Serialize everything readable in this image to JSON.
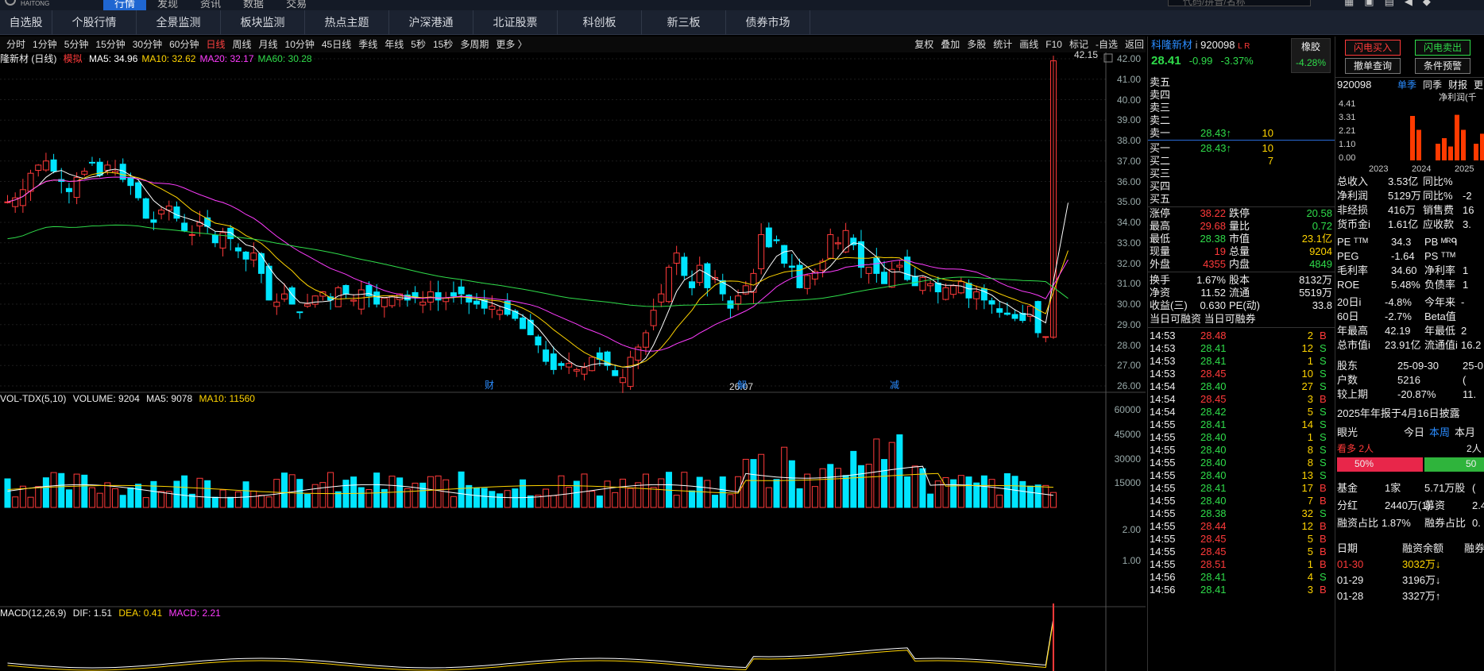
{
  "topbar": {
    "logo": "HAITONG",
    "menu": [
      "行情",
      "发现",
      "资讯",
      "数据",
      "交易"
    ],
    "active": 0,
    "search_placeholder": "代码/拼音/名称",
    "icons": [
      "grid-icon",
      "screen-icon",
      "quote-icon",
      "back-icon",
      "pin-icon"
    ]
  },
  "nav": [
    "自选股",
    "个股行情",
    "全景监测",
    "板块监测",
    "热点主题",
    "沪深港通",
    "北证股票",
    "科创板",
    "新三板",
    "债券市场"
  ],
  "periods": [
    "分时",
    "1分钟",
    "5分钟",
    "15分钟",
    "30分钟",
    "60分钟",
    "日线",
    "周线",
    "月线",
    "10分钟",
    "45日线",
    "季线",
    "年线",
    "5秒",
    "15秒",
    "多周期",
    "更多 〉"
  ],
  "active_period": "日线",
  "tools": [
    "复权",
    "叠加",
    "多股",
    "统计",
    "画线",
    "F10",
    "标记",
    "-自选",
    "返回"
  ],
  "main": {
    "title": "隆新材 (日线)",
    "mode": "模拟",
    "ma": [
      {
        "label": "MA5: 34.96",
        "color": "#ffffff"
      },
      {
        "label": "MA10: 32.62",
        "color": "#ffd400"
      },
      {
        "label": "MA20: 32.17",
        "color": "#ff3cff"
      },
      {
        "label": "MA60: 30.28",
        "color": "#2fdc4a"
      }
    ],
    "high_label": "42.15",
    "low_label": "26.07",
    "yaxis": [
      "42.00",
      "41.00",
      "40.00",
      "39.00",
      "38.00",
      "37.00",
      "36.00",
      "35.00",
      "34.00",
      "33.00",
      "32.00",
      "31.00",
      "30.00",
      "29.00",
      "28.00",
      "27.00",
      "26.00"
    ],
    "markers": [
      "财",
      "解",
      "减"
    ]
  },
  "vol": {
    "title": "VOL-TDX(5,10)",
    "volume": "VOLUME: 9204",
    "ma5": "MA5: 9078",
    "ma10": "MA10: 11560",
    "yaxis": [
      "60000",
      "45000",
      "30000",
      "15000"
    ]
  },
  "macd": {
    "title": "MACD(12,26,9)",
    "dif": "DIF: 1.51",
    "dea": "DEA: 0.41",
    "macd": "MACD: 2.21",
    "yaxis": [
      "2.00",
      "1.00"
    ]
  },
  "chart_data": {
    "type": "candlestick",
    "symbol": "920098",
    "period": "日线",
    "ylim": [
      26,
      42
    ],
    "ma": {
      "MA5": 34.96,
      "MA10": 32.62,
      "MA20": 32.17,
      "MA60": 30.28
    },
    "last": {
      "high": 42.15,
      "low_mark": 26.07
    },
    "volume": {
      "last": 9204,
      "ma5": 9078,
      "ma10": 11560,
      "ylim": [
        0,
        60000
      ]
    },
    "macd": {
      "dif": 1.51,
      "dea": 0.41,
      "macd": 2.21
    }
  },
  "quote": {
    "name": "科隆新材",
    "code": "920098",
    "flags": "L R",
    "price": "28.41",
    "change": "-0.99",
    "pct": "-3.37%",
    "sector": "橡胶",
    "sector_pct": "-4.28%",
    "asks": [
      {
        "label": "卖五",
        "p": "",
        "v": ""
      },
      {
        "label": "卖四",
        "p": "",
        "v": ""
      },
      {
        "label": "卖三",
        "p": "",
        "v": ""
      },
      {
        "label": "卖二",
        "p": "",
        "v": ""
      },
      {
        "label": "卖一",
        "p": "28.43↑",
        "v": "10"
      }
    ],
    "bids": [
      {
        "label": "买一",
        "p": "28.43↑",
        "v": "10"
      },
      {
        "label": "买二",
        "p": "",
        "v": "7"
      },
      {
        "label": "买三",
        "p": "",
        "v": ""
      },
      {
        "label": "买四",
        "p": "",
        "v": ""
      },
      {
        "label": "买五",
        "p": "",
        "v": ""
      }
    ],
    "stats": [
      [
        "涨停",
        "38.22",
        "跌停",
        "20.58"
      ],
      [
        "最高",
        "29.68",
        "量比",
        "0.72"
      ],
      [
        "最低",
        "28.38",
        "市值",
        "23.1亿"
      ],
      [
        "现量",
        "19",
        "总量",
        "9204"
      ],
      [
        "外盘",
        "4355",
        "内盘",
        "4849"
      ]
    ],
    "stats2": [
      [
        "换手",
        "1.67%",
        "股本",
        "8132万"
      ],
      [
        "净资",
        "11.52",
        "流通",
        "5519万"
      ],
      [
        "收益(三)",
        "0.630",
        "PE(动)",
        "33.8"
      ]
    ],
    "ticks_header": "当日可融资 当日可融券",
    "ticks": [
      [
        "14:53",
        "28.48",
        "2",
        "B"
      ],
      [
        "14:53",
        "28.41",
        "12",
        "S"
      ],
      [
        "14:53",
        "28.41",
        "1",
        "S"
      ],
      [
        "14:53",
        "28.45",
        "10",
        "S"
      ],
      [
        "14:54",
        "28.40",
        "27",
        "S"
      ],
      [
        "14:54",
        "28.45",
        "3",
        "B"
      ],
      [
        "14:54",
        "28.42",
        "5",
        "S"
      ],
      [
        "14:55",
        "28.41",
        "14",
        "S"
      ],
      [
        "14:55",
        "28.40",
        "1",
        "S"
      ],
      [
        "14:55",
        "28.40",
        "8",
        "S"
      ],
      [
        "14:55",
        "28.40",
        "8",
        "S"
      ],
      [
        "14:55",
        "28.40",
        "13",
        "S"
      ],
      [
        "14:55",
        "28.41",
        "17",
        "B"
      ],
      [
        "14:55",
        "28.40",
        "7",
        "B"
      ],
      [
        "14:55",
        "28.38",
        "32",
        "S"
      ],
      [
        "14:55",
        "28.44",
        "12",
        "B"
      ],
      [
        "14:55",
        "28.45",
        "5",
        "B"
      ],
      [
        "14:55",
        "28.45",
        "5",
        "B"
      ],
      [
        "14:55",
        "28.51",
        "1",
        "B"
      ],
      [
        "14:56",
        "28.41",
        "4",
        "S"
      ],
      [
        "14:56",
        "28.41",
        "3",
        "B"
      ]
    ]
  },
  "side": {
    "btn_buy": "闪电买入",
    "btn_sell": "闪电卖出",
    "btn_cancel": "撤单查询",
    "btn_cond": "条件预警",
    "fin_code": "920098",
    "fin_tabs": [
      "单季",
      "同季",
      "财报",
      "更"
    ],
    "fin_title": "净利润(千",
    "fin_yaxis": [
      "4.41",
      "3.31",
      "2.21",
      "1.10",
      "0.00"
    ],
    "fin_xaxis": [
      "2023",
      "2024",
      "2025"
    ],
    "fin_bars": [
      0,
      0,
      0,
      0.8,
      0.55,
      0,
      0,
      0.3,
      0.4,
      0.25,
      0.82,
      0.55,
      0,
      0.3,
      0.48,
      0.65
    ],
    "kv": [
      [
        "总收入",
        "3.53亿",
        "同比%",
        ""
      ],
      [
        "净利润",
        "5129万",
        "同比%",
        "-2"
      ],
      [
        "非经损",
        "416万",
        "销售费",
        "16"
      ],
      [
        "货币金i",
        "1.61亿",
        "应收款",
        "3."
      ]
    ],
    "kv2": [
      [
        "PE ᵀᵀᴹ",
        "34.3",
        "PB ᴹᴿᑫ",
        ""
      ],
      [
        "PEG",
        "-1.64",
        "PS ᵀᵀᴹ",
        ""
      ],
      [
        "毛利率",
        "34.60",
        "净利率",
        "1"
      ],
      [
        "ROE",
        "5.48%",
        "负债率",
        "1"
      ]
    ],
    "kv3": [
      [
        "20日i",
        "-4.8%",
        "今年来",
        "-"
      ],
      [
        "60日",
        "-2.7%",
        "Beta值",
        ""
      ],
      [
        "年最高",
        "42.19",
        "年最低",
        "2"
      ],
      [
        "总市值i",
        "23.91亿",
        "流通值i",
        "16.2"
      ]
    ],
    "holders": [
      [
        "股东",
        "25-09-30",
        "25-0"
      ],
      [
        "户数",
        "5216",
        "("
      ],
      [
        "较上期",
        "-20.87%",
        "11."
      ]
    ],
    "notice": "2025年年报于4月16日披露",
    "eye": {
      "label": "眼光",
      "tabs": [
        "今日",
        "本周",
        "本月"
      ],
      "bull": "看多 2人",
      "bear": "2人",
      "bull_pct": "50%",
      "bear_pct": "50"
    },
    "fund": [
      [
        "基金",
        "1家",
        "5.71万股",
        "("
      ],
      [
        "分红",
        "2440万(1)",
        "募资",
        "2.42"
      ],
      [
        "融资占比",
        "1.87%",
        "融券占比",
        "0."
      ]
    ],
    "margin_header": [
      "日期",
      "融资余额",
      "融券"
    ],
    "margin": [
      [
        "01-30",
        "3032万↓"
      ],
      [
        "01-29",
        "3196万↓"
      ],
      [
        "01-28",
        "3327万↑"
      ]
    ]
  }
}
